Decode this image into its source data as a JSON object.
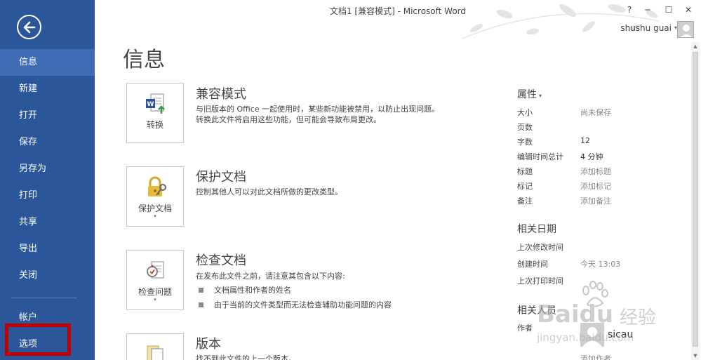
{
  "window": {
    "title": "文档1 [兼容模式] - Microsoft Word",
    "help": "?",
    "minimize": "─",
    "maximize": "☐",
    "close": "✕",
    "user_name": "shushu guai",
    "user_caret": "▾"
  },
  "sidebar": {
    "items": [
      {
        "label": "信息"
      },
      {
        "label": "新建"
      },
      {
        "label": "打开"
      },
      {
        "label": "保存"
      },
      {
        "label": "另存为"
      },
      {
        "label": "打印"
      },
      {
        "label": "共享"
      },
      {
        "label": "导出"
      },
      {
        "label": "关闭"
      },
      {
        "label": "帐户"
      },
      {
        "label": "选项"
      }
    ]
  },
  "main": {
    "heading": "信息",
    "sections": [
      {
        "button_label": "转换",
        "title": "兼容模式",
        "desc1": "与旧版本的 Office 一起使用时，某些新功能被禁用，以防止出现问题。",
        "desc2": "转换此文件将启用这些功能，但可能会导致布局更改。"
      },
      {
        "button_label": "保护文档",
        "button_caret": "▾",
        "title": "保护文档",
        "desc1": "控制其他人可以对此文档所做的更改类型。"
      },
      {
        "button_label": "检查问题",
        "button_caret": "▾",
        "title": "检查文档",
        "desc1": "在发布此文件之前，请注意其包含以下内容:",
        "bullets": [
          "文档属性和作者的姓名",
          "由于当前的文件类型而无法检查辅助功能问题的内容"
        ]
      },
      {
        "title": "版本",
        "desc1": "找不到此文件的上一个版本。"
      }
    ]
  },
  "properties": {
    "heading": "属性",
    "caret": "▾",
    "rows": [
      {
        "label": "大小",
        "value": "尚未保存"
      },
      {
        "label": "页数",
        "value": ""
      },
      {
        "label": "字数",
        "value": "12"
      },
      {
        "label": "编辑时间总计",
        "value": "4 分钟"
      },
      {
        "label": "标题",
        "value": "添加标题"
      },
      {
        "label": "标记",
        "value": "添加标记"
      },
      {
        "label": "备注",
        "value": "添加备注"
      }
    ],
    "dates_heading": "相关日期",
    "dates": [
      {
        "label": "上次修改时间",
        "value": ""
      },
      {
        "label": "创建时间",
        "value": "今天 13:03"
      },
      {
        "label": "上次打印时间",
        "value": ""
      }
    ],
    "people_heading": "相关人员",
    "author_label": "作者",
    "author_name": "sicau",
    "add_author": "添加作者"
  },
  "watermark": {
    "logo_text": "Bai",
    "logo_text2": "du",
    "cn_text": "经验",
    "url": "jingyan.baidu.com"
  }
}
